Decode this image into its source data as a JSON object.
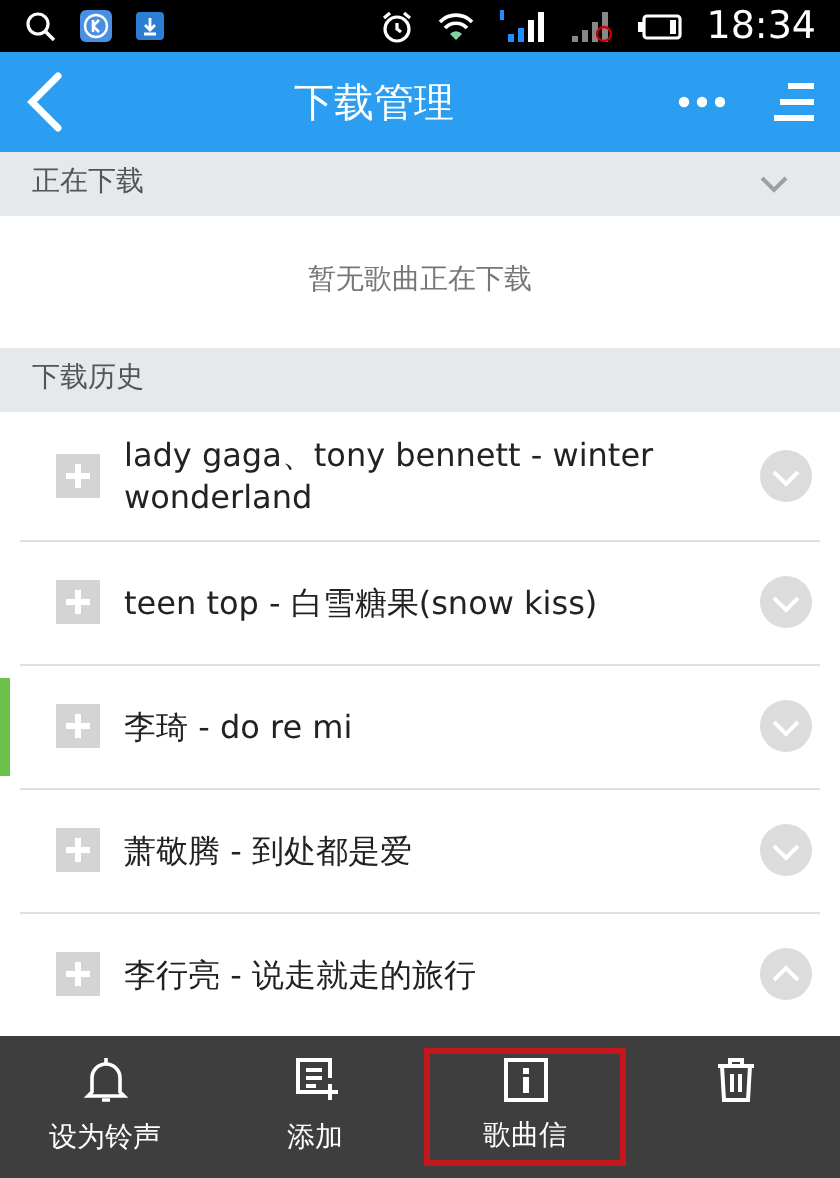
{
  "status_bar": {
    "time": "18:34"
  },
  "header": {
    "title": "下载管理"
  },
  "downloading": {
    "title": "正在下载",
    "expanded": false,
    "empty_message": "暂无歌曲正在下载"
  },
  "history": {
    "title": "下载历史",
    "items": [
      {
        "title": "lady gaga、tony bennett - winter wonderland",
        "selected": false,
        "expanded": false
      },
      {
        "title": "teen top - 白雪糖果(snow kiss)",
        "selected": false,
        "expanded": false
      },
      {
        "title": "李琦 - do re mi",
        "selected": true,
        "expanded": false
      },
      {
        "title": "萧敬腾 - 到处都是爱",
        "selected": false,
        "expanded": false
      },
      {
        "title": "李行亮 - 说走就走的旅行",
        "selected": false,
        "expanded": true
      }
    ]
  },
  "toolbar": [
    {
      "kind": "bell",
      "label": "设为铃声",
      "highlighted": false
    },
    {
      "kind": "add",
      "label": "添加",
      "highlighted": false
    },
    {
      "kind": "info",
      "label": "歌曲信",
      "highlighted": true
    },
    {
      "kind": "trash",
      "highlighted": false
    }
  ]
}
